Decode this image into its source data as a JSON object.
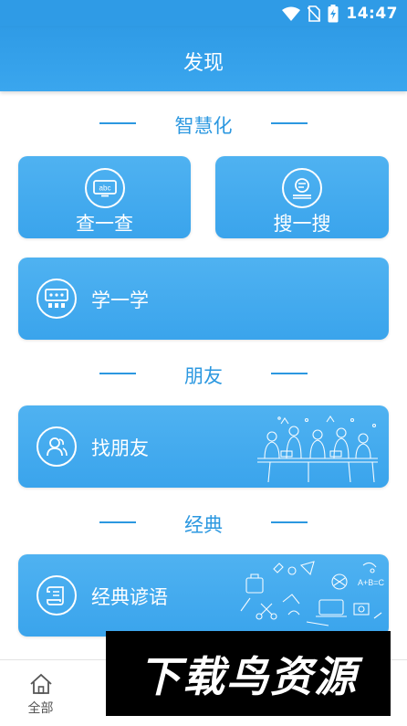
{
  "status_bar": {
    "time": "14:47"
  },
  "app_bar": {
    "title": "发现"
  },
  "sections": {
    "smart": {
      "title": "智慧化"
    },
    "friends": {
      "title": "朋友"
    },
    "classic": {
      "title": "经典"
    }
  },
  "cards": {
    "lookup": {
      "label": "查一查"
    },
    "search": {
      "label": "搜一搜"
    },
    "learn": {
      "label": "学一学"
    },
    "find_friends": {
      "label": "找朋友"
    },
    "proverbs": {
      "label": "经典谚语"
    }
  },
  "tab_bar": {
    "tabs": [
      {
        "label": "全部",
        "icon": "home-icon"
      },
      {
        "label": "",
        "icon": "tab-icon"
      },
      {
        "label": "",
        "icon": "tab-icon"
      },
      {
        "label": "",
        "icon": "tab-icon"
      },
      {
        "label": "",
        "icon": "tab-icon"
      }
    ]
  },
  "watermark": {
    "text": "下载鸟资源"
  },
  "colors": {
    "primary": "#2f9be6",
    "card": "#43abef",
    "accent_text": "#2c98e0"
  }
}
